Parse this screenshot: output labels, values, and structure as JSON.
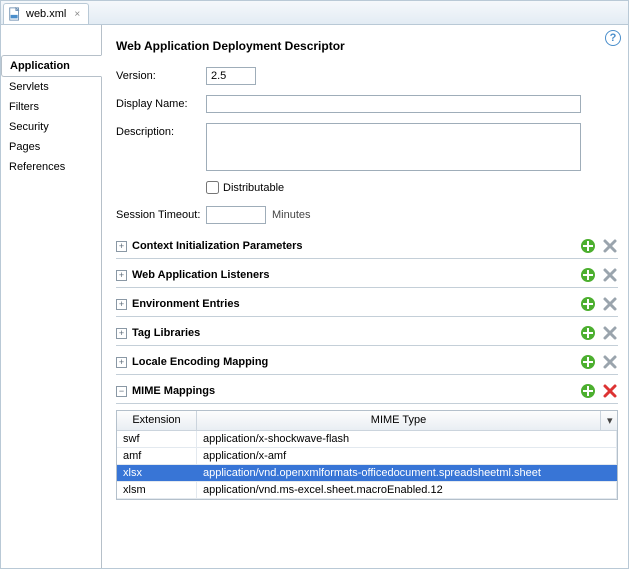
{
  "tab": {
    "label": "web.xml",
    "close": "×"
  },
  "nav": {
    "items": [
      {
        "label": "Application",
        "active": true
      },
      {
        "label": "Servlets"
      },
      {
        "label": "Filters"
      },
      {
        "label": "Security"
      },
      {
        "label": "Pages"
      },
      {
        "label": "References"
      }
    ]
  },
  "panel": {
    "title": "Web Application Deployment Descriptor",
    "version_label": "Version:",
    "version_value": "2.5",
    "display_name_label": "Display Name:",
    "display_name_value": "",
    "description_label": "Description:",
    "description_value": "",
    "distributable_label": "Distributable",
    "session_timeout_label": "Session Timeout:",
    "session_timeout_value": "",
    "session_timeout_unit": "Minutes"
  },
  "sections": [
    {
      "title": "Context Initialization Parameters",
      "expanded": false,
      "delete_active": false
    },
    {
      "title": "Web Application Listeners",
      "expanded": false,
      "delete_active": false
    },
    {
      "title": "Environment Entries",
      "expanded": false,
      "delete_active": false
    },
    {
      "title": "Tag Libraries",
      "expanded": false,
      "delete_active": false
    },
    {
      "title": "Locale Encoding Mapping",
      "expanded": false,
      "delete_active": false
    },
    {
      "title": "MIME Mappings",
      "expanded": true,
      "delete_active": true
    }
  ],
  "mime_table": {
    "col_ext": "Extension",
    "col_mime": "MIME Type",
    "rows": [
      {
        "ext": "swf",
        "mime": "application/x-shockwave-flash",
        "selected": false
      },
      {
        "ext": "amf",
        "mime": "application/x-amf",
        "selected": false
      },
      {
        "ext": "xlsx",
        "mime": "application/vnd.openxmlformats-officedocument.spreadsheetml.sheet",
        "selected": true
      },
      {
        "ext": "xlsm",
        "mime": "application/vnd.ms-excel.sheet.macroEnabled.12",
        "selected": false
      }
    ]
  },
  "help_glyph": "?"
}
